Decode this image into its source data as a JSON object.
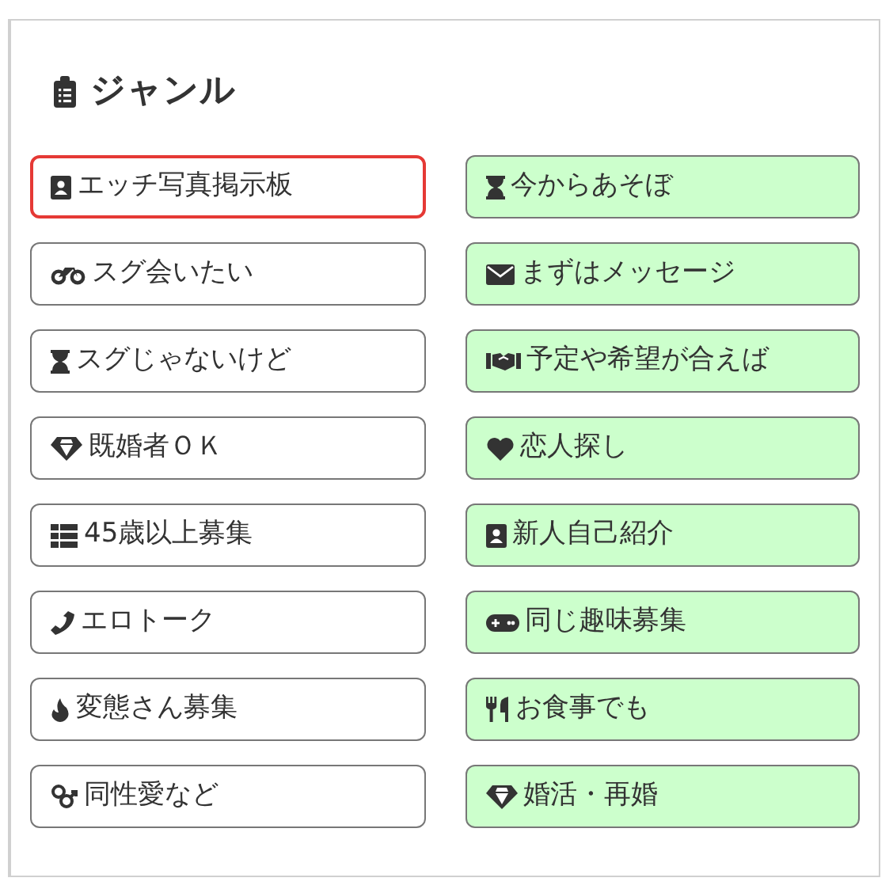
{
  "section": {
    "title": "ジャンル"
  },
  "genres": [
    {
      "label": "エッチ写真掲示板",
      "selected": true,
      "color": "#ffffff"
    },
    {
      "label": "今からあそぼ",
      "selected": false,
      "color": "#ccffcc"
    },
    {
      "label": "スグ会いたい",
      "selected": false,
      "color": "#ffffff"
    },
    {
      "label": "まずはメッセージ",
      "selected": false,
      "color": "#ccffcc"
    },
    {
      "label": "スグじゃないけど",
      "selected": false,
      "color": "#ffffff"
    },
    {
      "label": "予定や希望が合えば",
      "selected": false,
      "color": "#ccffcc"
    },
    {
      "label": "既婚者ＯＫ",
      "selected": false,
      "color": "#ffffff"
    },
    {
      "label": "恋人探し",
      "selected": false,
      "color": "#ccffcc"
    },
    {
      "label": "45歳以上募集",
      "selected": false,
      "color": "#ffffff"
    },
    {
      "label": "新人自己紹介",
      "selected": false,
      "color": "#ccffcc"
    },
    {
      "label": "エロトーク",
      "selected": false,
      "color": "#ffffff"
    },
    {
      "label": "同じ趣味募集",
      "selected": false,
      "color": "#ccffcc"
    },
    {
      "label": "変態さん募集",
      "selected": false,
      "color": "#ffffff"
    },
    {
      "label": "お食事でも",
      "selected": false,
      "color": "#ccffcc"
    },
    {
      "label": "同性愛など",
      "selected": false,
      "color": "#ffffff"
    },
    {
      "label": "婚活・再婚",
      "selected": false,
      "color": "#ccffcc"
    }
  ]
}
